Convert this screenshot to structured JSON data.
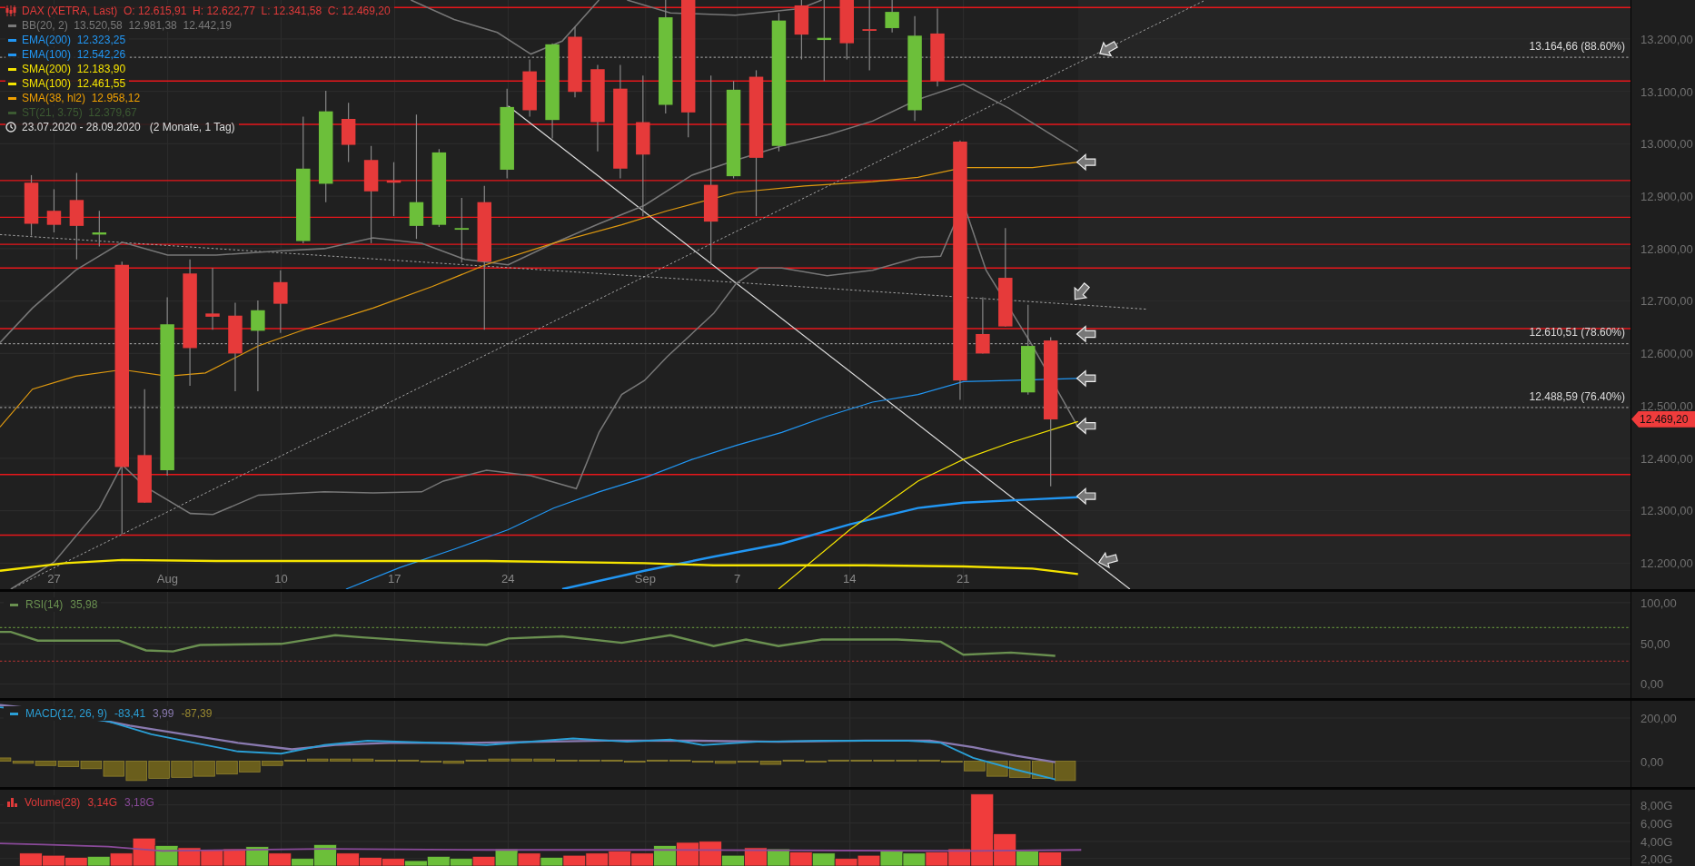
{
  "legend": {
    "title": "DAX (XETRA, Last)  O: 12.615,91  H: 12.622,77  L: 12.341,58  C: 12.469,20",
    "indicators": [
      {
        "text": "BB(20, 2)  13.520,58  12.981,38  12.442,19",
        "color": "#7a7a7a"
      },
      {
        "text": "EMA(200)  12.323,25",
        "color": "#2196f3"
      },
      {
        "text": "EMA(100)  12.542,26",
        "color": "#2196f3"
      },
      {
        "text": "SMA(200)  12.183,90",
        "color": "#f5e400"
      },
      {
        "text": "SMA(100)  12.461,55",
        "color": "#f5e400"
      },
      {
        "text": "SMA(38, hl2)  12.958,12",
        "color": "#f0a000"
      },
      {
        "text": "ST(21, 3.75)  12.379,67",
        "color": "#3c5a32"
      }
    ],
    "range": "23.07.2020 - 28.09.2020   (2 Monate, 1 Tag)"
  },
  "price_panel": {
    "fib_levels": [
      "13.164,66 (88.60%)",
      "12.610,51 (78.60%)",
      "12.488,59 (76.40%)"
    ],
    "x_labels": [
      "27",
      "Aug",
      "10",
      "17",
      "24",
      "Sep",
      "7",
      "14",
      "21"
    ],
    "y_labels": [
      "13.200,00",
      "13.100,00",
      "13.000,00",
      "12.900,00",
      "12.800,00",
      "12.700,00",
      "12.600,00",
      "12.500,00",
      "12.400,00",
      "12.300,00",
      "12.200,00"
    ],
    "last_price": "12.469,20"
  },
  "rsi_panel": {
    "label": "RSI(14)",
    "value": "35,98",
    "y_labels": [
      "100,00",
      "50,00",
      "0,00"
    ]
  },
  "macd_panel": {
    "label": "MACD(12, 26, 9)",
    "values": [
      "-83,41",
      "3,99",
      "-87,39"
    ],
    "y_labels": [
      "200,00",
      "0,00"
    ]
  },
  "volume_panel": {
    "label": "Volume(28)",
    "values": [
      "3,14G",
      "3,18G"
    ],
    "y_labels": [
      "8,00G",
      "6,00G",
      "4,00G",
      "2,00G"
    ]
  }
}
